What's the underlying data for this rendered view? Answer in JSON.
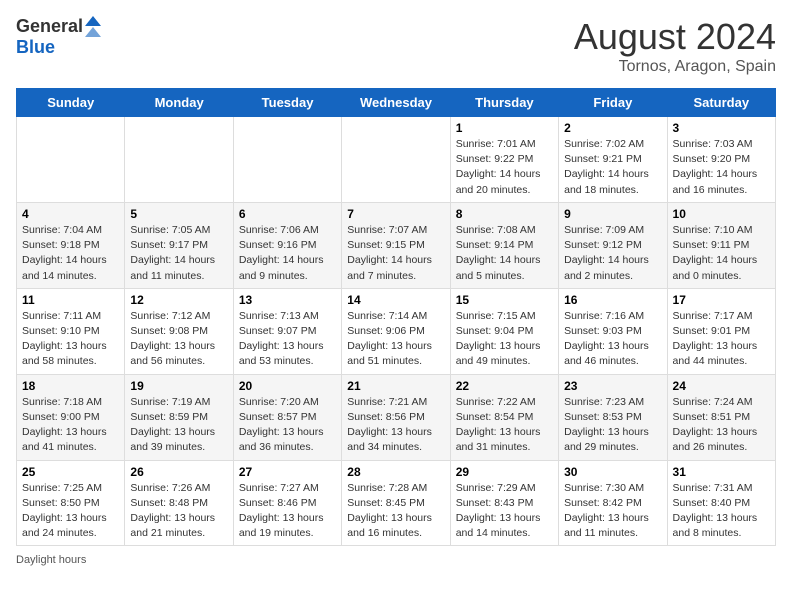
{
  "header": {
    "logo_general": "General",
    "logo_blue": "Blue",
    "title": "August 2024",
    "subtitle": "Tornos, Aragon, Spain"
  },
  "columns": [
    "Sunday",
    "Monday",
    "Tuesday",
    "Wednesday",
    "Thursday",
    "Friday",
    "Saturday"
  ],
  "weeks": [
    [
      {
        "day": "",
        "info": ""
      },
      {
        "day": "",
        "info": ""
      },
      {
        "day": "",
        "info": ""
      },
      {
        "day": "",
        "info": ""
      },
      {
        "day": "1",
        "info": "Sunrise: 7:01 AM\nSunset: 9:22 PM\nDaylight: 14 hours and 20 minutes."
      },
      {
        "day": "2",
        "info": "Sunrise: 7:02 AM\nSunset: 9:21 PM\nDaylight: 14 hours and 18 minutes."
      },
      {
        "day": "3",
        "info": "Sunrise: 7:03 AM\nSunset: 9:20 PM\nDaylight: 14 hours and 16 minutes."
      }
    ],
    [
      {
        "day": "4",
        "info": "Sunrise: 7:04 AM\nSunset: 9:18 PM\nDaylight: 14 hours and 14 minutes."
      },
      {
        "day": "5",
        "info": "Sunrise: 7:05 AM\nSunset: 9:17 PM\nDaylight: 14 hours and 11 minutes."
      },
      {
        "day": "6",
        "info": "Sunrise: 7:06 AM\nSunset: 9:16 PM\nDaylight: 14 hours and 9 minutes."
      },
      {
        "day": "7",
        "info": "Sunrise: 7:07 AM\nSunset: 9:15 PM\nDaylight: 14 hours and 7 minutes."
      },
      {
        "day": "8",
        "info": "Sunrise: 7:08 AM\nSunset: 9:14 PM\nDaylight: 14 hours and 5 minutes."
      },
      {
        "day": "9",
        "info": "Sunrise: 7:09 AM\nSunset: 9:12 PM\nDaylight: 14 hours and 2 minutes."
      },
      {
        "day": "10",
        "info": "Sunrise: 7:10 AM\nSunset: 9:11 PM\nDaylight: 14 hours and 0 minutes."
      }
    ],
    [
      {
        "day": "11",
        "info": "Sunrise: 7:11 AM\nSunset: 9:10 PM\nDaylight: 13 hours and 58 minutes."
      },
      {
        "day": "12",
        "info": "Sunrise: 7:12 AM\nSunset: 9:08 PM\nDaylight: 13 hours and 56 minutes."
      },
      {
        "day": "13",
        "info": "Sunrise: 7:13 AM\nSunset: 9:07 PM\nDaylight: 13 hours and 53 minutes."
      },
      {
        "day": "14",
        "info": "Sunrise: 7:14 AM\nSunset: 9:06 PM\nDaylight: 13 hours and 51 minutes."
      },
      {
        "day": "15",
        "info": "Sunrise: 7:15 AM\nSunset: 9:04 PM\nDaylight: 13 hours and 49 minutes."
      },
      {
        "day": "16",
        "info": "Sunrise: 7:16 AM\nSunset: 9:03 PM\nDaylight: 13 hours and 46 minutes."
      },
      {
        "day": "17",
        "info": "Sunrise: 7:17 AM\nSunset: 9:01 PM\nDaylight: 13 hours and 44 minutes."
      }
    ],
    [
      {
        "day": "18",
        "info": "Sunrise: 7:18 AM\nSunset: 9:00 PM\nDaylight: 13 hours and 41 minutes."
      },
      {
        "day": "19",
        "info": "Sunrise: 7:19 AM\nSunset: 8:59 PM\nDaylight: 13 hours and 39 minutes."
      },
      {
        "day": "20",
        "info": "Sunrise: 7:20 AM\nSunset: 8:57 PM\nDaylight: 13 hours and 36 minutes."
      },
      {
        "day": "21",
        "info": "Sunrise: 7:21 AM\nSunset: 8:56 PM\nDaylight: 13 hours and 34 minutes."
      },
      {
        "day": "22",
        "info": "Sunrise: 7:22 AM\nSunset: 8:54 PM\nDaylight: 13 hours and 31 minutes."
      },
      {
        "day": "23",
        "info": "Sunrise: 7:23 AM\nSunset: 8:53 PM\nDaylight: 13 hours and 29 minutes."
      },
      {
        "day": "24",
        "info": "Sunrise: 7:24 AM\nSunset: 8:51 PM\nDaylight: 13 hours and 26 minutes."
      }
    ],
    [
      {
        "day": "25",
        "info": "Sunrise: 7:25 AM\nSunset: 8:50 PM\nDaylight: 13 hours and 24 minutes."
      },
      {
        "day": "26",
        "info": "Sunrise: 7:26 AM\nSunset: 8:48 PM\nDaylight: 13 hours and 21 minutes."
      },
      {
        "day": "27",
        "info": "Sunrise: 7:27 AM\nSunset: 8:46 PM\nDaylight: 13 hours and 19 minutes."
      },
      {
        "day": "28",
        "info": "Sunrise: 7:28 AM\nSunset: 8:45 PM\nDaylight: 13 hours and 16 minutes."
      },
      {
        "day": "29",
        "info": "Sunrise: 7:29 AM\nSunset: 8:43 PM\nDaylight: 13 hours and 14 minutes."
      },
      {
        "day": "30",
        "info": "Sunrise: 7:30 AM\nSunset: 8:42 PM\nDaylight: 13 hours and 11 minutes."
      },
      {
        "day": "31",
        "info": "Sunrise: 7:31 AM\nSunset: 8:40 PM\nDaylight: 13 hours and 8 minutes."
      }
    ]
  ],
  "footer": "Daylight hours"
}
